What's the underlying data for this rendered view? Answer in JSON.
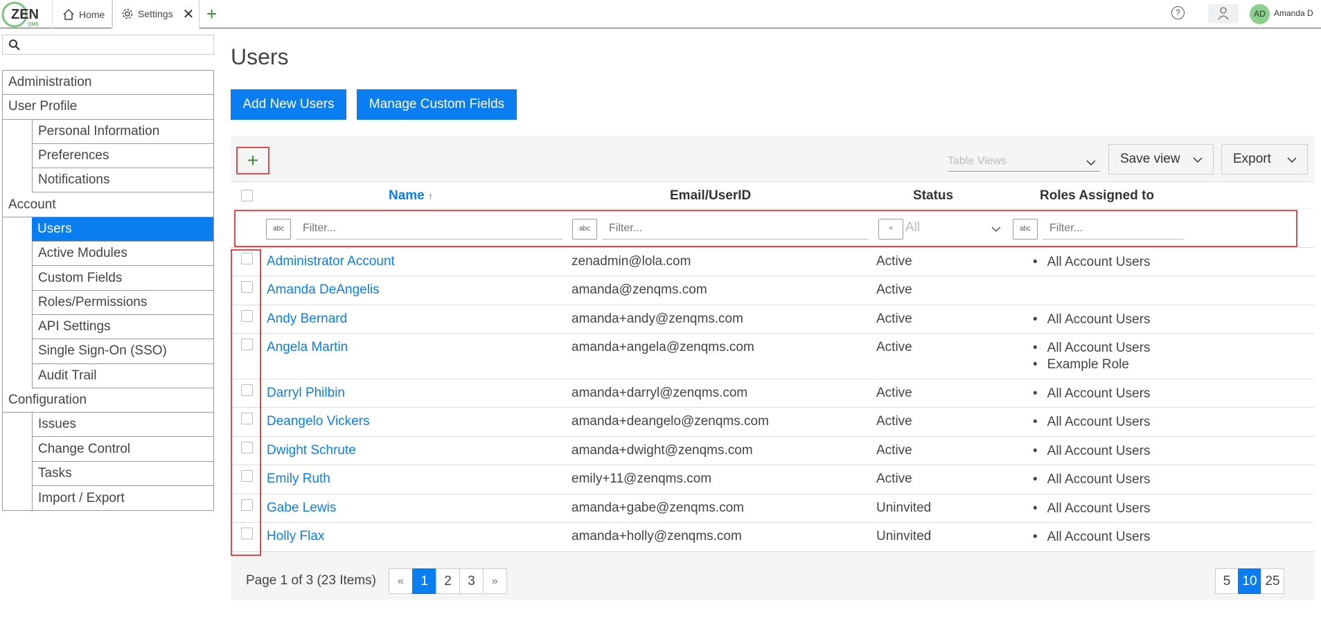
{
  "topbar": {
    "logo_text": "ZEN",
    "logo_sub": "QMS",
    "tabs": [
      {
        "label": "Home",
        "icon": "home-icon"
      },
      {
        "label": "Settings",
        "icon": "gear-icon"
      }
    ],
    "new_tab": "+",
    "help": "?",
    "avatar_initials": "AD",
    "user_name": "Amanda D"
  },
  "sidebar": {
    "search_placeholder": "",
    "items": [
      {
        "label": "Administration",
        "level": 0
      },
      {
        "label": "User Profile",
        "level": 0
      },
      {
        "label": "Personal Information",
        "level": 1
      },
      {
        "label": "Preferences",
        "level": 1
      },
      {
        "label": "Notifications",
        "level": 1
      },
      {
        "label": "Account",
        "level": 0
      },
      {
        "label": "Users",
        "level": 1,
        "active": true
      },
      {
        "label": "Active Modules",
        "level": 1
      },
      {
        "label": "Custom Fields",
        "level": 1
      },
      {
        "label": "Roles/Permissions",
        "level": 1
      },
      {
        "label": "API Settings",
        "level": 1
      },
      {
        "label": "Single Sign-On (SSO)",
        "level": 1
      },
      {
        "label": "Audit Trail",
        "level": 1
      },
      {
        "label": "Configuration",
        "level": 0
      },
      {
        "label": "Issues",
        "level": 1
      },
      {
        "label": "Change Control",
        "level": 1
      },
      {
        "label": "Tasks",
        "level": 1
      },
      {
        "label": "Import / Export",
        "level": 1
      }
    ]
  },
  "main": {
    "title": "Users",
    "add_users_label": "Add New Users",
    "manage_fields_label": "Manage Custom Fields",
    "toolbar": {
      "add": "+",
      "table_views_placeholder": "Table Views",
      "save_view_label": "Save view",
      "export_label": "Export"
    },
    "columns": {
      "name": "Name",
      "sort_indicator": "↑",
      "email": "Email/UserID",
      "status": "Status",
      "roles": "Roles Assigned to"
    },
    "filters": {
      "placeholder": "Filter...",
      "status_value": "All",
      "text_op": "abc",
      "eq_op": "="
    },
    "rows": [
      {
        "name": "Administrator Account",
        "email": "zenadmin@lola.com",
        "status": "Active",
        "roles": [
          "All Account Users"
        ]
      },
      {
        "name": "Amanda DeAngelis",
        "email": "amanda@zenqms.com",
        "status": "Active",
        "roles": []
      },
      {
        "name": "Andy Bernard",
        "email": "amanda+andy@zenqms.com",
        "status": "Active",
        "roles": [
          "All Account Users"
        ]
      },
      {
        "name": "Angela Martin",
        "email": "amanda+angela@zenqms.com",
        "status": "Active",
        "roles": [
          "All Account Users",
          "Example Role"
        ]
      },
      {
        "name": "Darryl Philbin",
        "email": "amanda+darryl@zenqms.com",
        "status": "Active",
        "roles": [
          "All Account Users"
        ]
      },
      {
        "name": "Deangelo Vickers",
        "email": "amanda+deangelo@zenqms.com",
        "status": "Active",
        "roles": [
          "All Account Users"
        ]
      },
      {
        "name": "Dwight Schrute",
        "email": "amanda+dwight@zenqms.com",
        "status": "Active",
        "roles": [
          "All Account Users"
        ]
      },
      {
        "name": "Emily Ruth",
        "email": "emily+11@zenqms.com",
        "status": "Active",
        "roles": [
          "All Account Users"
        ]
      },
      {
        "name": "Gabe Lewis",
        "email": "amanda+gabe@zenqms.com",
        "status": "Uninvited",
        "roles": [
          "All Account Users"
        ]
      },
      {
        "name": "Holly Flax",
        "email": "amanda+holly@zenqms.com",
        "status": "Uninvited",
        "roles": [
          "All Account Users"
        ]
      }
    ],
    "pager": {
      "info": "Page 1 of 3 (23 Items)",
      "prev": "«",
      "next": "»",
      "pages": [
        "1",
        "2",
        "3"
      ],
      "current_page": "1",
      "sizes": [
        "5",
        "10",
        "25"
      ],
      "current_size": "10"
    }
  },
  "colors": {
    "accent": "#0a7ef0",
    "highlight": "#e34a4a",
    "add_green": "#3a8a3a"
  }
}
